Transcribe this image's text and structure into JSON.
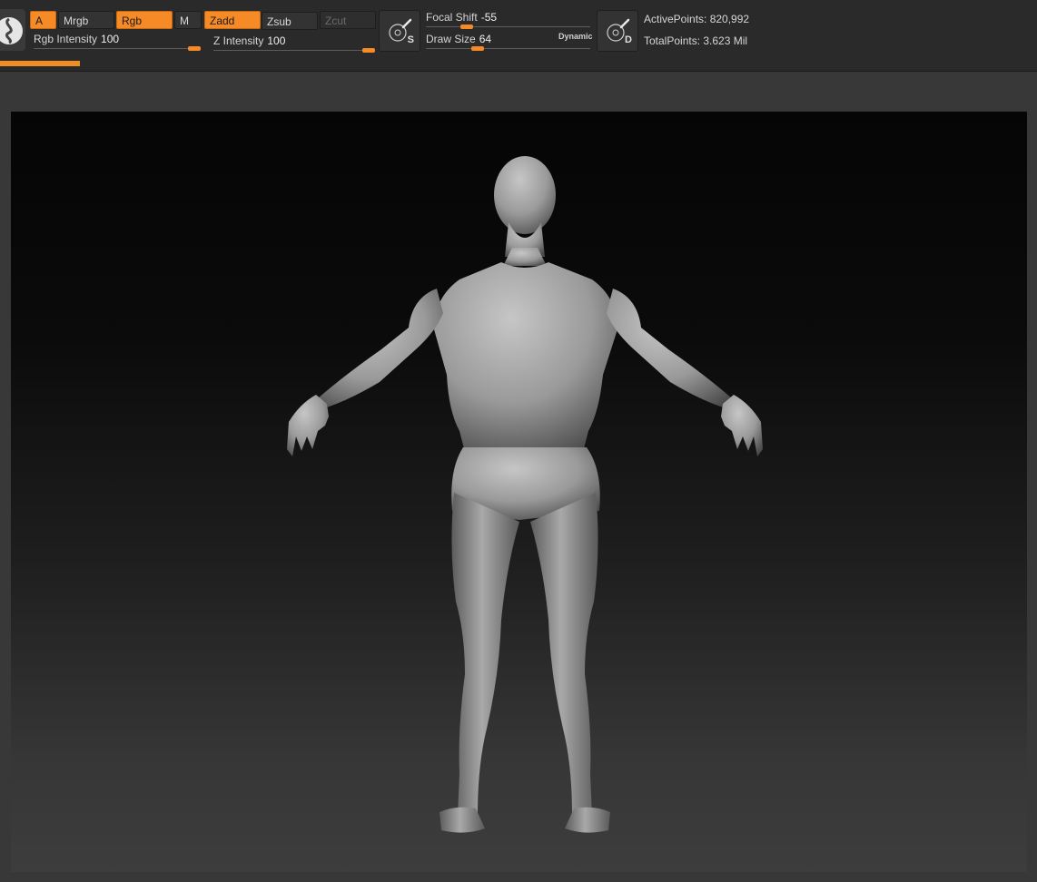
{
  "toolbar": {
    "a_label": "A",
    "mrgb_label": "Mrgb",
    "rgb_label": "Rgb",
    "m_label": "M",
    "zadd_label": "Zadd",
    "zsub_label": "Zsub",
    "zcut_label": "Zcut",
    "rgb_intensity": {
      "label": "Rgb Intensity",
      "value": "100",
      "fraction": 1.0
    },
    "z_intensity": {
      "label": "Z Intensity",
      "value": "100",
      "fraction": 1.0
    },
    "focal_shift": {
      "label": "Focal Shift",
      "value": "-55",
      "fraction": 0.225
    },
    "draw_size": {
      "label": "Draw Size",
      "value": "64",
      "fraction": 0.3
    },
    "dynamic_label": "Dynamic",
    "brush_s_letter": "S",
    "brush_d_letter": "D",
    "progress_fraction": 0.077
  },
  "stats": {
    "active_points": "ActivePoints: 820,992",
    "total_points": "TotalPoints: 3.623 Mil"
  },
  "icons": {
    "material": "material-sphere-icon",
    "brush_s": "standard-brush-icon",
    "brush_d": "draw-brush-icon"
  },
  "colors": {
    "accent": "#f58a26",
    "toolbar_bg": "#2a2a2a",
    "ui_bg": "#383838",
    "model": "#9a9a9a"
  }
}
